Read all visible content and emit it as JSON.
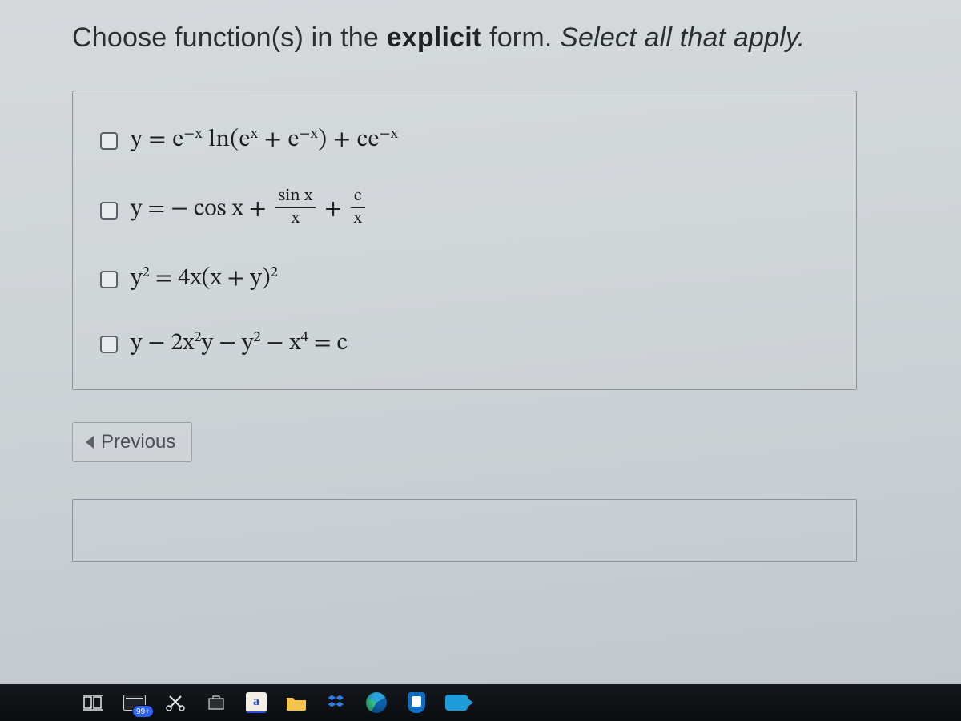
{
  "question": {
    "prefix": "Choose function(s) in the ",
    "strong": "explicit",
    "middle": " form.  ",
    "em": "Select all that apply."
  },
  "options": {
    "a": {
      "pre": "y = e",
      "exp1": "−x",
      "mid1": " ln(e",
      "exp2": "x",
      "mid2": " + e",
      "exp3": "−x",
      "mid3": ") + ce",
      "exp4": "−x"
    },
    "b": {
      "pre": "y = − cos x + ",
      "frac1_num": "sin x",
      "frac1_den": "x",
      "plus": " + ",
      "frac2_num": "c",
      "frac2_den": "x"
    },
    "c": {
      "lhs1": "y",
      "lhs_exp": "2",
      "eq": " = 4x(x + y)",
      "rhs_exp": "2"
    },
    "d": {
      "t1": "y − 2x",
      "e1": "2",
      "t2": "y − y",
      "e2": "2",
      "t3": " − x",
      "e3": "4",
      "t4": " = c"
    }
  },
  "nav": {
    "previous": "Previous"
  },
  "taskbar": {
    "mail_badge": "99+",
    "amazon_letter": "a"
  }
}
